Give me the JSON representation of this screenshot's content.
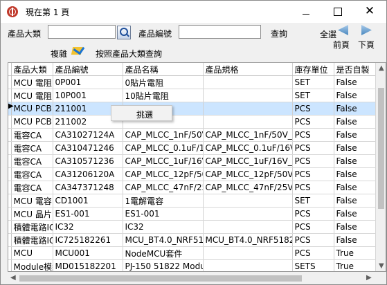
{
  "window": {
    "title": "現在第 1 頁",
    "minimize_icon": "minimize-icon",
    "maximize_icon": "maximize-icon",
    "close_icon": "close-icon"
  },
  "search": {
    "category_label": "產品大類",
    "category_value": "",
    "product_code_label": "產品編號",
    "product_code_value": "",
    "query_label": "查詢",
    "select_all_label": "全選",
    "copy_label": "複雜",
    "category_query_label": "按照產品大類查詢",
    "prev_label": "前頁",
    "next_label": "下頁"
  },
  "table": {
    "columns": [
      "產品大類",
      "產品編號",
      "產品名稱",
      "產品規格",
      "庫存單位",
      "是否自製"
    ],
    "rows": [
      [
        "MCU 電阻",
        "0P001",
        "0貼片電阻",
        "",
        "SET",
        "False"
      ],
      [
        "MCU 電阻",
        "10P001",
        "10貼片電阻",
        "",
        "SET",
        "False"
      ],
      [
        "MCU PCB",
        "211001",
        "",
        "",
        "PCS",
        "False"
      ],
      [
        "MCU PCB",
        "211002",
        "",
        "",
        "PCS",
        "False"
      ],
      [
        "電容CA",
        "CA31027124A",
        "CAP_MLCC_1nF/50V_",
        "CAP_MLCC_1nF/50V_K_",
        "PCS",
        "False"
      ],
      [
        "電容CA",
        "CA310471246",
        "CAP_MLCC_0.1uF/16V",
        "CAP_MLCC_0.1uF/16V_K",
        "PCS",
        "False"
      ],
      [
        "電容CA",
        "CA310571236",
        "CAP_MLCC_1uF/16V_",
        "CAP_MLCC_1uF/16V_K_",
        "PCS",
        "False"
      ],
      [
        "電容CA",
        "CA31206120A",
        "CAP_MLCC_12pF/50V",
        "CAP_MLCC_12pF/50V_J",
        "PCS",
        "False"
      ],
      [
        "電容CA",
        "CA347371248",
        "CAP_MLCC_47nF/25V",
        "CAP_MLCC_47nF/25V_K",
        "PCS",
        "False"
      ],
      [
        "MCU 電容",
        "CD1001",
        "1電解電容",
        "",
        "SET",
        "False"
      ],
      [
        "MCU 晶片",
        "ES1-001",
        "ES1-001",
        "",
        "PCS",
        "False"
      ],
      [
        "積體電路IC",
        "IC32",
        "IC32",
        "",
        "PCS",
        "False"
      ],
      [
        "積體電路IC",
        "IC725182261",
        "MCU_BT4.0_NRF5182",
        "MCU_BT4.0_NRF51822_I",
        "PCS",
        "False"
      ],
      [
        "MCU",
        "MCU001",
        "NodeMCU套件",
        "",
        "PCS",
        "True"
      ],
      [
        "Module模組",
        "MD015182201",
        "PJ-150 51822 Module",
        "",
        "SETS",
        "True"
      ]
    ],
    "selected_row_index": 2
  },
  "context_menu": {
    "select_label": "挑選"
  }
}
